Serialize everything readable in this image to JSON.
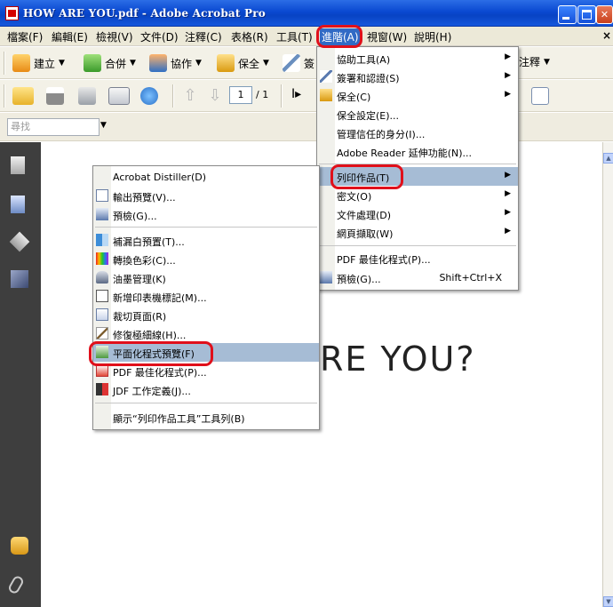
{
  "window": {
    "title": "HOW ARE YOU.pdf - Adobe Acrobat Pro"
  },
  "menubar": {
    "items": [
      "檔案(F)",
      "編輯(E)",
      "檢視(V)",
      "文件(D)",
      "注釋(C)",
      "表格(R)",
      "工具(T)",
      "進階(A)",
      "視窗(W)",
      "說明(H)"
    ],
    "close": "×"
  },
  "toolbar1": {
    "create": "建立",
    "combine": "合併",
    "collaborate": "協作",
    "secure": "保全",
    "sign_partial": "簽",
    "comment_partial": "注釋"
  },
  "toolbar2": {
    "page_current": "1",
    "page_total": "/ 1"
  },
  "toolbar3": {
    "search_placeholder": "尋找"
  },
  "document": {
    "visible_text": "RE YOU?"
  },
  "advanced_menu": {
    "items": [
      {
        "label": "協助工具(A)",
        "submenu": true
      },
      {
        "label": "簽署和認證(S)",
        "submenu": true
      },
      {
        "label": "保全(C)",
        "submenu": true
      },
      {
        "label": "保全設定(E)..."
      },
      {
        "label": "管理信任的身分(I)..."
      },
      {
        "label": "Adobe Reader 延伸功能(N)..."
      },
      {
        "label": "列印作品(T)",
        "submenu": true,
        "highlighted": true
      },
      {
        "label": "密文(O)",
        "submenu": true
      },
      {
        "label": "文件處理(D)",
        "submenu": true
      },
      {
        "label": "網頁擷取(W)",
        "submenu": true
      },
      {
        "label": "PDF 最佳化程式(P)..."
      },
      {
        "label": "預檢(G)...",
        "shortcut": "Shift+Ctrl+X"
      }
    ]
  },
  "print_production_menu": {
    "items": [
      {
        "label": "Acrobat Distiller(D)"
      },
      {
        "label": "輸出預覽(V)..."
      },
      {
        "label": "預檢(G)..."
      },
      {
        "label": "補漏白預置(T)..."
      },
      {
        "label": "轉換色彩(C)..."
      },
      {
        "label": "油墨管理(K)"
      },
      {
        "label": "新增印表機標記(M)..."
      },
      {
        "label": "裁切頁面(R)"
      },
      {
        "label": "修復極細線(H)..."
      },
      {
        "label": "平面化程式預覽(F)",
        "highlighted": true
      },
      {
        "label": "PDF 最佳化程式(P)..."
      },
      {
        "label": "JDF 工作定義(J)..."
      },
      {
        "label": "顯示“列印作品工具”工具列(B)"
      }
    ]
  },
  "colors": {
    "titlebar": "#0a49d1",
    "menu_highlight": "#a6bcd5",
    "callout_ring": "#e0101b",
    "leftnav": "#3e3e3e"
  }
}
